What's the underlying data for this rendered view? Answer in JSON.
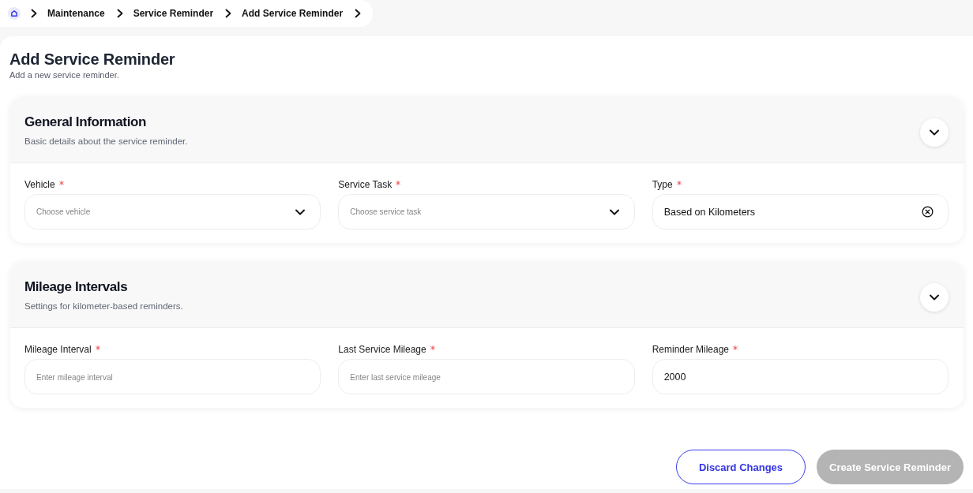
{
  "breadcrumb": {
    "items": [
      {
        "label": "Maintenance"
      },
      {
        "label": "Service Reminder"
      },
      {
        "label": "Add Service Reminder"
      }
    ]
  },
  "header": {
    "title": "Add Service Reminder",
    "subtitle": "Add a new service reminder."
  },
  "sections": [
    {
      "title": "General Information",
      "description": "Basic details about the service reminder.",
      "expanded": true,
      "fields": [
        {
          "label": "Vehicle",
          "required": true,
          "kind": "select",
          "placeholder": "Choose vehicle"
        },
        {
          "label": "Service Task",
          "required": true,
          "kind": "select",
          "placeholder": "Choose service task"
        },
        {
          "label": "Type",
          "required": true,
          "kind": "select",
          "value": "Based on Kilometers",
          "clearable": true
        }
      ]
    },
    {
      "title": "Mileage Intervals",
      "description": "Settings for kilometer-based reminders.",
      "expanded": true,
      "fields": [
        {
          "label": "Mileage Interval",
          "required": true,
          "kind": "input",
          "placeholder": "Enter mileage interval"
        },
        {
          "label": "Last Service Mileage",
          "required": true,
          "kind": "input",
          "placeholder": "Enter last service mileage"
        },
        {
          "label": "Reminder Mileage",
          "required": true,
          "kind": "input",
          "value": "2000"
        }
      ]
    }
  ],
  "buttons": [
    {
      "label": "Discard Changes",
      "kind": "secondary",
      "disabled": false
    },
    {
      "label": "Create Service Reminder",
      "kind": "primary",
      "disabled": true
    }
  ]
}
